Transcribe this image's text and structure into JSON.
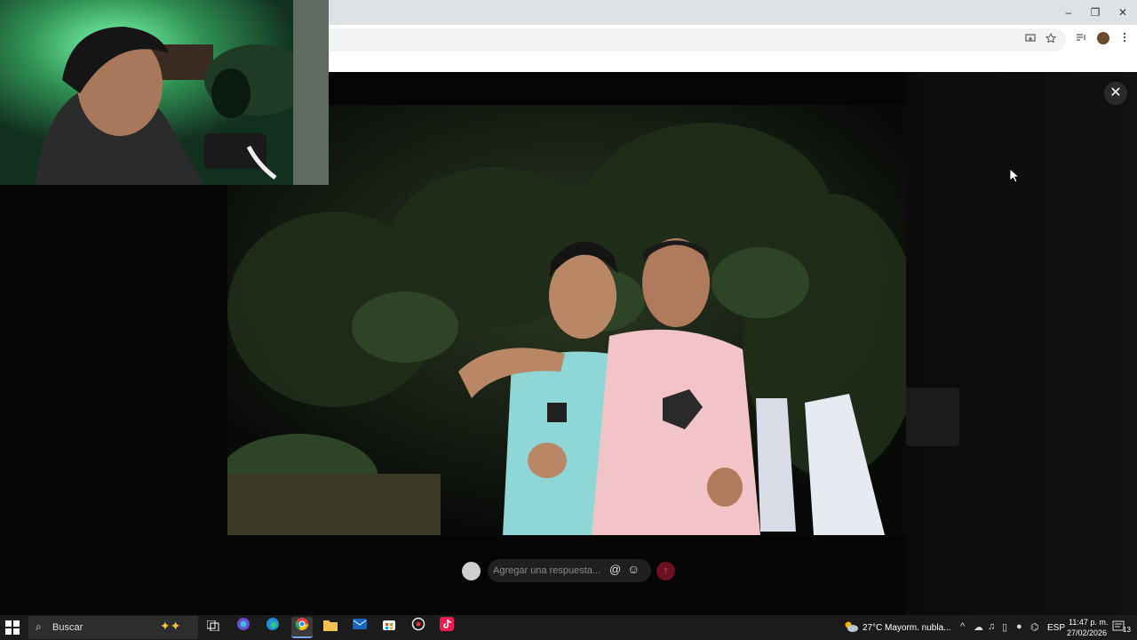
{
  "browser": {
    "window_controls": {
      "minimize": "–",
      "restore": "❐",
      "close": "✕"
    }
  },
  "viewer": {
    "close_label": "✕",
    "reply": {
      "placeholder": "Agregar una respuesta...",
      "mention_symbol": "@",
      "emoji_symbol": "☺",
      "send_symbol": "↑"
    }
  },
  "taskbar": {
    "search_placeholder": "Buscar",
    "weather": {
      "temp": "27°C",
      "desc": "Mayorm. nubla..."
    },
    "language": "ESP",
    "time": "11:47 p. m.",
    "date": "27/02/2026",
    "notification_count": "13"
  }
}
